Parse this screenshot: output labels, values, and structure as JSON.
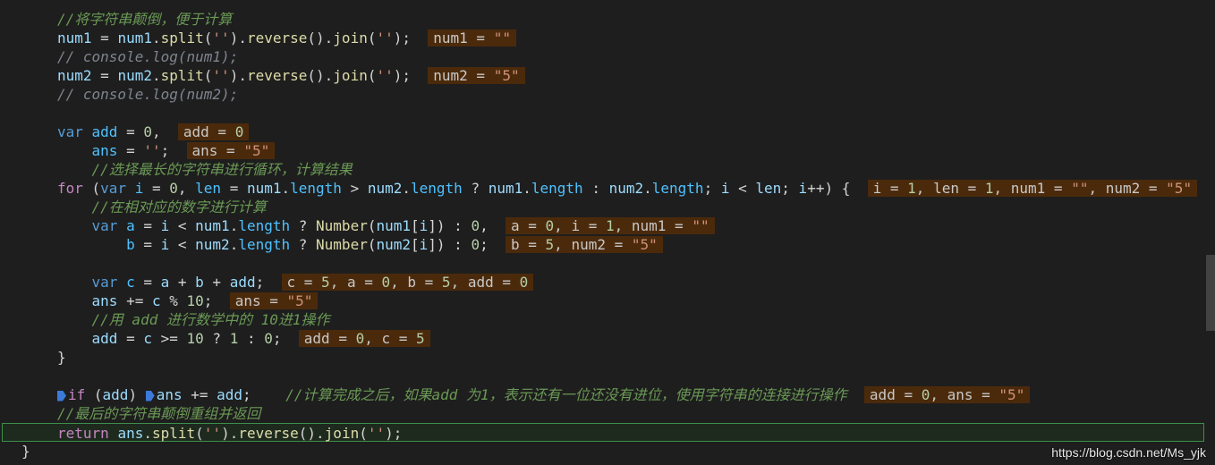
{
  "lines": [
    {
      "id": "l1",
      "parts": [
        [
          "cmt",
          "//将字符串颠倒，便于计算"
        ]
      ]
    },
    {
      "id": "l2",
      "parts": [
        [
          "var",
          "num1"
        ],
        [
          "op",
          " = "
        ],
        [
          "var",
          "num1"
        ],
        [
          "op",
          "."
        ],
        [
          "fn",
          "split"
        ],
        [
          "op",
          "("
        ],
        [
          "str",
          "''"
        ],
        [
          "op",
          ")."
        ],
        [
          "fn",
          "reverse"
        ],
        [
          "op",
          "()."
        ],
        [
          "fn",
          "join"
        ],
        [
          "op",
          "("
        ],
        [
          "str",
          "''"
        ],
        [
          "op",
          ");"
        ]
      ],
      "inline": [
        [
          "t",
          "num1 = "
        ],
        [
          "s",
          "\"\""
        ]
      ]
    },
    {
      "id": "l3",
      "parts": [
        [
          "cmt-grey",
          "// console.log(num1);"
        ]
      ]
    },
    {
      "id": "l4",
      "parts": [
        [
          "var",
          "num2"
        ],
        [
          "op",
          " = "
        ],
        [
          "var",
          "num2"
        ],
        [
          "op",
          "."
        ],
        [
          "fn",
          "split"
        ],
        [
          "op",
          "("
        ],
        [
          "str",
          "''"
        ],
        [
          "op",
          ")."
        ],
        [
          "fn",
          "reverse"
        ],
        [
          "op",
          "()."
        ],
        [
          "fn",
          "join"
        ],
        [
          "op",
          "("
        ],
        [
          "str",
          "''"
        ],
        [
          "op",
          ");"
        ]
      ],
      "inline": [
        [
          "t",
          "num2 = "
        ],
        [
          "s",
          "\"5\""
        ]
      ]
    },
    {
      "id": "l5",
      "parts": [
        [
          "cmt-grey",
          "// console.log(num2);"
        ]
      ]
    },
    {
      "id": "l6",
      "parts": []
    },
    {
      "id": "l7",
      "parts": [
        [
          "kw2",
          "var "
        ],
        [
          "prop",
          "add"
        ],
        [
          "op",
          " = "
        ],
        [
          "num",
          "0"
        ],
        [
          "op",
          ","
        ]
      ],
      "inline": [
        [
          "t",
          "add = "
        ],
        [
          "v",
          "0"
        ]
      ]
    },
    {
      "id": "l8",
      "parts": [
        [
          "op",
          "    "
        ],
        [
          "prop",
          "ans"
        ],
        [
          "op",
          " = "
        ],
        [
          "str",
          "''"
        ],
        [
          "op",
          ";"
        ]
      ],
      "inline": [
        [
          "t",
          "ans = "
        ],
        [
          "s",
          "\"5\""
        ]
      ]
    },
    {
      "id": "l9",
      "parts": [
        [
          "op",
          "    "
        ],
        [
          "cmt",
          "//选择最长的字符串进行循环，计算结果"
        ]
      ]
    },
    {
      "id": "l10",
      "parts": [
        [
          "kw",
          "for"
        ],
        [
          "op",
          " ("
        ],
        [
          "kw2",
          "var "
        ],
        [
          "prop",
          "i"
        ],
        [
          "op",
          " = "
        ],
        [
          "num",
          "0"
        ],
        [
          "op",
          ", "
        ],
        [
          "prop",
          "len"
        ],
        [
          "op",
          " = "
        ],
        [
          "var",
          "num1"
        ],
        [
          "op",
          "."
        ],
        [
          "prop",
          "length"
        ],
        [
          "op",
          " > "
        ],
        [
          "var",
          "num2"
        ],
        [
          "op",
          "."
        ],
        [
          "prop",
          "length"
        ],
        [
          "op",
          " ? "
        ],
        [
          "var",
          "num1"
        ],
        [
          "op",
          "."
        ],
        [
          "prop",
          "length"
        ],
        [
          "op",
          " : "
        ],
        [
          "var",
          "num2"
        ],
        [
          "op",
          "."
        ],
        [
          "prop",
          "length"
        ],
        [
          "op",
          "; "
        ],
        [
          "var",
          "i"
        ],
        [
          "op",
          " < "
        ],
        [
          "var",
          "len"
        ],
        [
          "op",
          "; "
        ],
        [
          "var",
          "i"
        ],
        [
          "op",
          "++) {"
        ]
      ],
      "inline": [
        [
          "t",
          "i = "
        ],
        [
          "v",
          "1"
        ],
        [
          "t",
          ", len = "
        ],
        [
          "v",
          "1"
        ],
        [
          "t",
          ", num1 = "
        ],
        [
          "s",
          "\"\""
        ],
        [
          "t",
          ", num2 = "
        ],
        [
          "s",
          "\"5\""
        ]
      ]
    },
    {
      "id": "l11",
      "parts": [
        [
          "op",
          "    "
        ],
        [
          "cmt",
          "//在相对应的数字进行计算"
        ]
      ]
    },
    {
      "id": "l12",
      "parts": [
        [
          "op",
          "    "
        ],
        [
          "kw2",
          "var "
        ],
        [
          "prop",
          "a"
        ],
        [
          "op",
          " = "
        ],
        [
          "var",
          "i"
        ],
        [
          "op",
          " < "
        ],
        [
          "var",
          "num1"
        ],
        [
          "op",
          "."
        ],
        [
          "prop",
          "length"
        ],
        [
          "op",
          " ? "
        ],
        [
          "fn",
          "Number"
        ],
        [
          "op",
          "("
        ],
        [
          "var",
          "num1"
        ],
        [
          "op",
          "["
        ],
        [
          "var",
          "i"
        ],
        [
          "op",
          "]) : "
        ],
        [
          "num",
          "0"
        ],
        [
          "op",
          ","
        ]
      ],
      "inline": [
        [
          "t",
          "a = "
        ],
        [
          "v",
          "0"
        ],
        [
          "t",
          ", i = "
        ],
        [
          "v",
          "1"
        ],
        [
          "t",
          ", num1 = "
        ],
        [
          "s",
          "\"\""
        ]
      ]
    },
    {
      "id": "l13",
      "parts": [
        [
          "op",
          "        "
        ],
        [
          "prop",
          "b"
        ],
        [
          "op",
          " = "
        ],
        [
          "var",
          "i"
        ],
        [
          "op",
          " < "
        ],
        [
          "var",
          "num2"
        ],
        [
          "op",
          "."
        ],
        [
          "prop",
          "length"
        ],
        [
          "op",
          " ? "
        ],
        [
          "fn",
          "Number"
        ],
        [
          "op",
          "("
        ],
        [
          "var",
          "num2"
        ],
        [
          "op",
          "["
        ],
        [
          "var",
          "i"
        ],
        [
          "op",
          "]) : "
        ],
        [
          "num",
          "0"
        ],
        [
          "op",
          ";"
        ]
      ],
      "inline": [
        [
          "t",
          "b = "
        ],
        [
          "v",
          "5"
        ],
        [
          "t",
          ", num2 = "
        ],
        [
          "s",
          "\"5\""
        ]
      ]
    },
    {
      "id": "l14",
      "parts": []
    },
    {
      "id": "l15",
      "parts": [
        [
          "op",
          "    "
        ],
        [
          "kw2",
          "var "
        ],
        [
          "prop",
          "c"
        ],
        [
          "op",
          " = "
        ],
        [
          "var",
          "a"
        ],
        [
          "op",
          " + "
        ],
        [
          "var",
          "b"
        ],
        [
          "op",
          " + "
        ],
        [
          "var",
          "add"
        ],
        [
          "op",
          ";"
        ]
      ],
      "inline": [
        [
          "t",
          "c = "
        ],
        [
          "v",
          "5"
        ],
        [
          "t",
          ", a = "
        ],
        [
          "v",
          "0"
        ],
        [
          "t",
          ", b = "
        ],
        [
          "v",
          "5"
        ],
        [
          "t",
          ", add = "
        ],
        [
          "v",
          "0"
        ]
      ]
    },
    {
      "id": "l16",
      "parts": [
        [
          "op",
          "    "
        ],
        [
          "var",
          "ans"
        ],
        [
          "op",
          " += "
        ],
        [
          "var",
          "c"
        ],
        [
          "op",
          " % "
        ],
        [
          "num",
          "10"
        ],
        [
          "op",
          ";"
        ]
      ],
      "inline": [
        [
          "t",
          "ans = "
        ],
        [
          "s",
          "\"5\""
        ]
      ]
    },
    {
      "id": "l17",
      "parts": [
        [
          "op",
          "    "
        ],
        [
          "cmt",
          "//用 add 进行数学中的 10进1操作"
        ]
      ]
    },
    {
      "id": "l18",
      "parts": [
        [
          "op",
          "    "
        ],
        [
          "var",
          "add"
        ],
        [
          "op",
          " = "
        ],
        [
          "var",
          "c"
        ],
        [
          "op",
          " >= "
        ],
        [
          "num",
          "10"
        ],
        [
          "op",
          " ? "
        ],
        [
          "num",
          "1"
        ],
        [
          "op",
          " : "
        ],
        [
          "num",
          "0"
        ],
        [
          "op",
          ";"
        ]
      ],
      "inline": [
        [
          "t",
          "add = "
        ],
        [
          "v",
          "0"
        ],
        [
          "t",
          ", c = "
        ],
        [
          "v",
          "5"
        ]
      ]
    },
    {
      "id": "l19",
      "parts": [
        [
          "op",
          "}"
        ]
      ]
    },
    {
      "id": "l20",
      "parts": []
    },
    {
      "id": "l21",
      "bp": true,
      "parts": [
        [
          "kw",
          "if"
        ],
        [
          "op",
          " ("
        ],
        [
          "var",
          "add"
        ],
        [
          "op",
          ") "
        ],
        [
          "bp",
          ""
        ],
        [
          "var",
          "ans"
        ],
        [
          "op",
          " += "
        ],
        [
          "var",
          "add"
        ],
        [
          "op",
          ";    "
        ],
        [
          "cmt",
          "//计算完成之后，如果add 为1，表示还有一位还没有进位，使用字符串的连接进行操作"
        ]
      ],
      "inline": [
        [
          "t",
          "add = "
        ],
        [
          "v",
          "0"
        ],
        [
          "t",
          ", ans = "
        ],
        [
          "s",
          "\"5\""
        ]
      ]
    },
    {
      "id": "l22",
      "parts": [
        [
          "cmt",
          "//最后的字符串颠倒重组并返回"
        ]
      ]
    },
    {
      "id": "l23",
      "current": true,
      "parts": [
        [
          "kw",
          "return"
        ],
        [
          "op",
          " "
        ],
        [
          "var",
          "ans"
        ],
        [
          "op",
          "."
        ],
        [
          "fn",
          "split"
        ],
        [
          "op",
          "("
        ],
        [
          "str",
          "''"
        ],
        [
          "op",
          ")."
        ],
        [
          "fn",
          "reverse"
        ],
        [
          "op",
          "()."
        ],
        [
          "fn",
          "join"
        ],
        [
          "op",
          "("
        ],
        [
          "str",
          "''"
        ],
        [
          "op",
          ");"
        ]
      ]
    },
    {
      "id": "l24",
      "parts": [
        [
          "op",
          "}"
        ]
      ]
    }
  ],
  "watermark": "https://blog.csdn.net/Ms_yjk",
  "colors": {
    "background": "#1e1e1e",
    "inline_hint": "#4b2a0b",
    "current_line_border": "#3c8f4a"
  }
}
